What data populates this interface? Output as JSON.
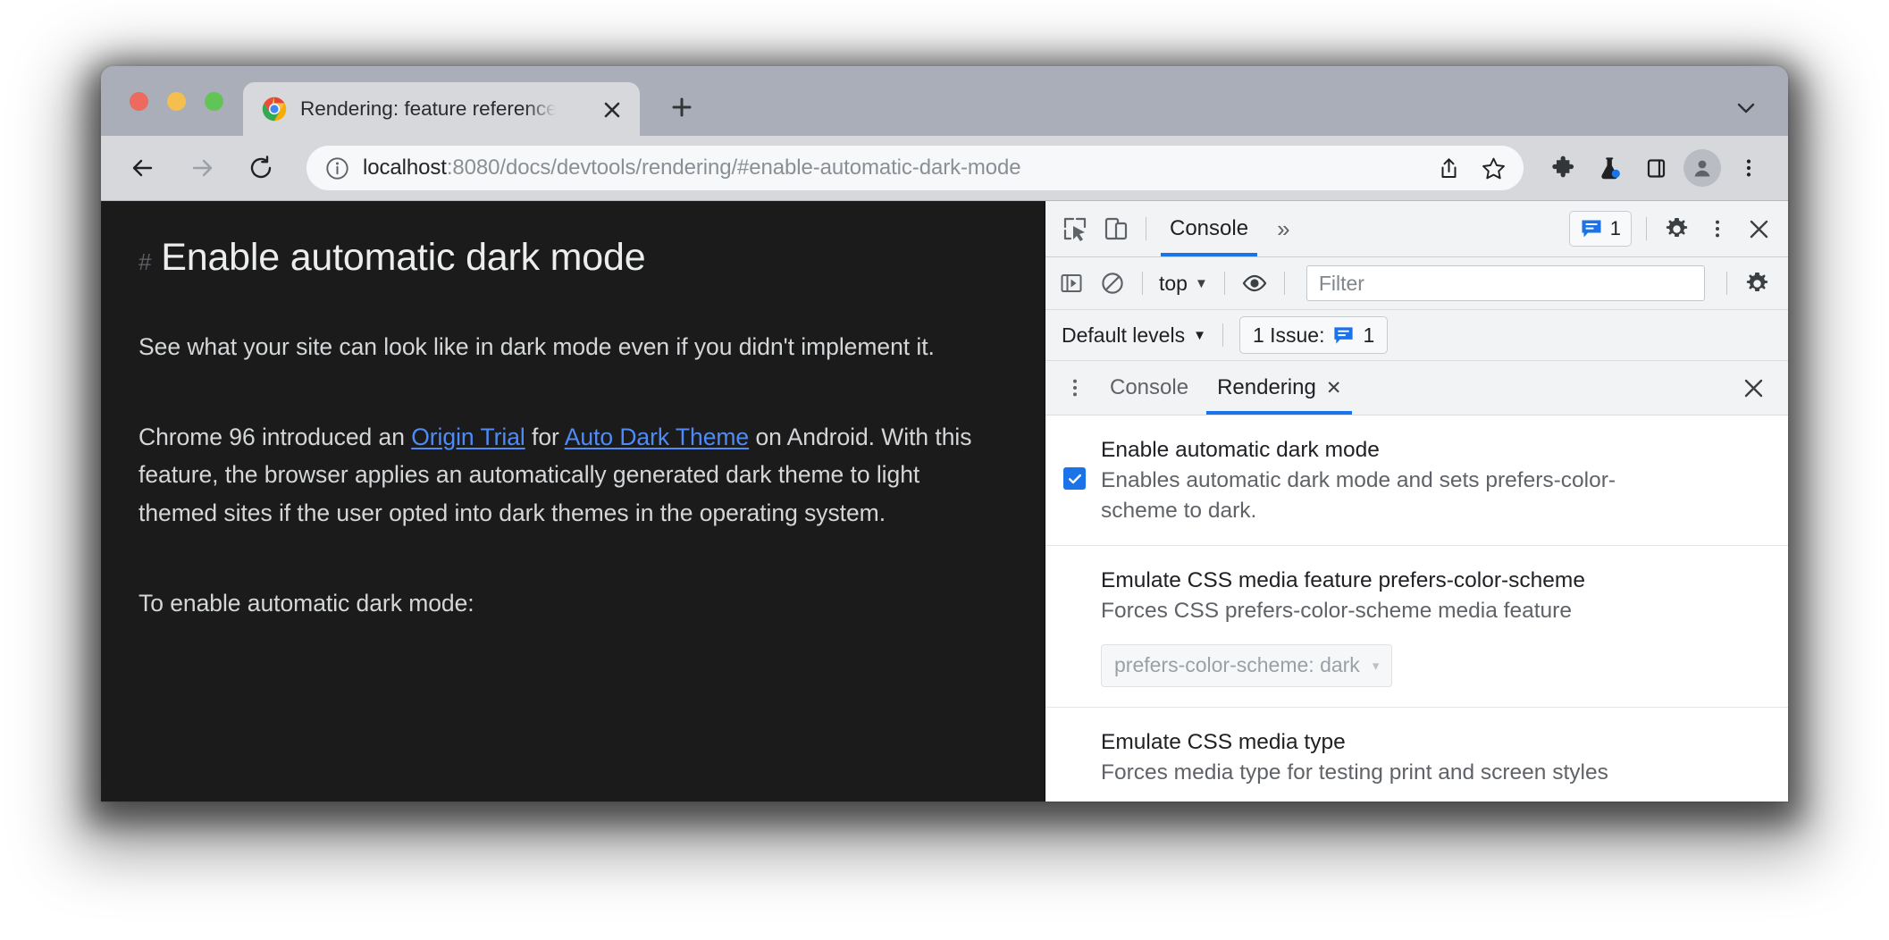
{
  "browser": {
    "tab": {
      "title": "Rendering: feature reference - C",
      "favicon_name": "chrome-favicon",
      "close_label": "✕"
    },
    "new_tab_label": "+",
    "window_chevron_label": "⌄",
    "traffic_lights": [
      "close",
      "minimize",
      "zoom"
    ],
    "nav": {
      "back_label": "←",
      "forward_label": "→",
      "reload_label": "↻"
    },
    "omnibox": {
      "host": "localhost",
      "path": ":8080/docs/devtools/rendering/#enable-automatic-dark-mode",
      "site_info_icon": "info-circle-icon",
      "share_icon": "share-icon",
      "bookmark_icon": "star-icon"
    },
    "toolbar_icons": [
      "extensions-puzzle-icon",
      "devtools-experiment-flask-icon",
      "side-panel-icon",
      "profile-avatar-icon",
      "browser-menu-icon"
    ]
  },
  "page": {
    "heading_anchor": "#",
    "heading": "Enable automatic dark mode",
    "paragraphs": {
      "intro": "See what your site can look like in dark mode even if you didn't implement it.",
      "chrome_pre": "Chrome 96 introduced an ",
      "link_origin_trial": "Origin Trial",
      "chrome_mid": " for ",
      "link_auto_dark_theme": "Auto Dark Theme",
      "chrome_post": " on Android. With this feature, the browser applies an automatically generated dark theme to light themed sites if the user opted into dark themes in the operating system.",
      "to_enable": "To enable automatic dark mode:"
    }
  },
  "devtools": {
    "main_toolbar": {
      "inspect_icon": "inspect-element-icon",
      "device_icon": "device-toolbar-icon",
      "active_tab": "Console",
      "more_tabs_label": "»",
      "issues_count": "1",
      "issues_icon": "issues-message-icon",
      "settings_icon": "gear-icon",
      "more_icon": "more-vertical-icon",
      "close_icon": "close-icon"
    },
    "filter_toolbar": {
      "sidebar_icon": "console-sidebar-icon",
      "clear_icon": "clear-console-icon",
      "context": "top",
      "context_caret": "▼",
      "eye_icon": "live-expression-eye-icon",
      "filter_placeholder": "Filter",
      "settings_icon": "gear-icon"
    },
    "levels_toolbar": {
      "levels_label": "Default levels",
      "levels_caret": "▼",
      "issue_text": "1 Issue:",
      "issue_count": "1",
      "issue_icon": "issues-message-icon"
    },
    "drawer": {
      "menu_icon": "more-vertical-icon",
      "tabs": [
        {
          "label": "Console",
          "active": false,
          "closable": false
        },
        {
          "label": "Rendering",
          "active": true,
          "closable": true
        }
      ],
      "tab_close_label": "✕",
      "close_icon": "close-icon"
    },
    "rendering": {
      "sections": [
        {
          "title": "Enable automatic dark mode",
          "description": "Enables automatic dark mode and sets prefers-color-scheme to dark.",
          "checkbox": true,
          "checkmark": "✓",
          "select": null
        },
        {
          "title": "Emulate CSS media feature prefers-color-scheme",
          "description": "Forces CSS prefers-color-scheme media feature",
          "checkbox": false,
          "select": "prefers-color-scheme: dark",
          "select_caret": "▾"
        },
        {
          "title": "Emulate CSS media type",
          "description": "Forces media type for testing print and screen styles",
          "checkbox": false,
          "select": null
        }
      ]
    }
  },
  "colors": {
    "accent_blue": "#1a73e8",
    "link_blue": "#4f8bf7",
    "page_background": "#1b1b1b",
    "devtools_background": "#f1f3f4",
    "chrome_frame": "#a9aeb9"
  }
}
